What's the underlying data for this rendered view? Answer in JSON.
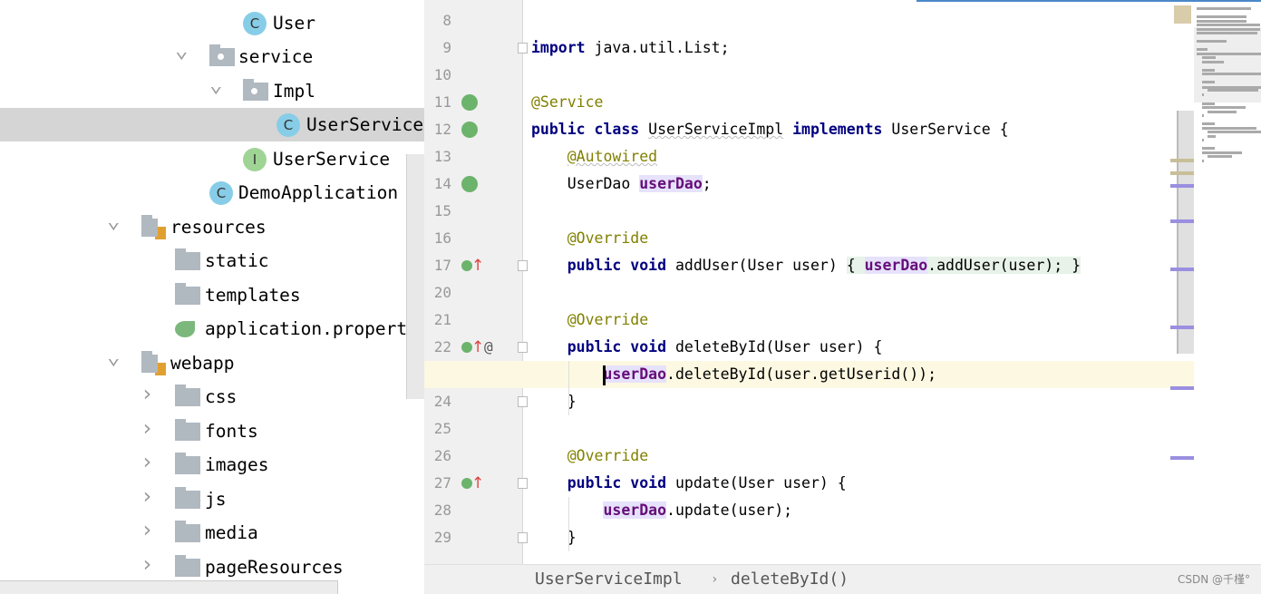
{
  "tree": [
    {
      "label": "User",
      "icon": "class-icon",
      "depth": "c1"
    },
    {
      "label": "service",
      "icon": "package-icon",
      "expanded": true,
      "depth": "f1"
    },
    {
      "label": "Impl",
      "icon": "package-icon",
      "expanded": true,
      "depth": "f2"
    },
    {
      "label": "UserServiceImpl",
      "icon": "class-icon",
      "depth": "c2",
      "selected": true
    },
    {
      "label": "UserService",
      "icon": "interface-icon",
      "depth": "c1"
    },
    {
      "label": "DemoApplication",
      "icon": "spring-boot-class-icon",
      "depth": "c0"
    },
    {
      "label": "resources",
      "icon": "resources-folder-icon",
      "expanded": true,
      "depth": "r"
    },
    {
      "label": "static",
      "icon": "folder-icon",
      "depth": "rc"
    },
    {
      "label": "templates",
      "icon": "folder-icon",
      "depth": "rc"
    },
    {
      "label": "application.properties",
      "icon": "spring-properties-icon",
      "depth": "rc"
    },
    {
      "label": "webapp",
      "icon": "resources-folder-icon",
      "expanded": true,
      "depth": "r"
    },
    {
      "label": "css",
      "icon": "folder-icon",
      "collapsed": true,
      "depth": "rc"
    },
    {
      "label": "fonts",
      "icon": "folder-icon",
      "collapsed": true,
      "depth": "rc"
    },
    {
      "label": "images",
      "icon": "folder-icon",
      "collapsed": true,
      "depth": "rc"
    },
    {
      "label": "js",
      "icon": "folder-icon",
      "collapsed": true,
      "depth": "rc"
    },
    {
      "label": "media",
      "icon": "folder-icon",
      "collapsed": true,
      "depth": "rc"
    },
    {
      "label": "pageResources",
      "icon": "folder-icon",
      "collapsed": true,
      "depth": "rc"
    }
  ],
  "editor": {
    "lines": [
      {
        "n": "8",
        "tokens": []
      },
      {
        "n": "9",
        "fold": true,
        "tokens": [
          {
            "t": "import",
            "c": "kw"
          },
          {
            "t": " java.util.List;"
          }
        ]
      },
      {
        "n": "10",
        "tokens": []
      },
      {
        "n": "11",
        "gutter": "spring-bean-icon",
        "tokens": [
          {
            "t": "@Service",
            "c": "ann"
          }
        ]
      },
      {
        "n": "12",
        "gutter": "spring-class-icon",
        "tokens": [
          {
            "t": "public",
            "c": "kw"
          },
          {
            "t": " "
          },
          {
            "t": "class",
            "c": "kw"
          },
          {
            "t": " "
          },
          {
            "t": "UserServiceImpl",
            "c": "wavy"
          },
          {
            "t": " "
          },
          {
            "t": "implements",
            "c": "kw"
          },
          {
            "t": " UserService {"
          }
        ]
      },
      {
        "n": "13",
        "tokens": [
          {
            "t": "    "
          },
          {
            "t": "@Autowired",
            "c": "ann wavy"
          }
        ]
      },
      {
        "n": "14",
        "gutter": "spring-autowired-icon",
        "tokens": [
          {
            "t": "    UserDao "
          },
          {
            "t": "userDao",
            "c": "fld"
          },
          {
            "t": ";"
          }
        ]
      },
      {
        "n": "15",
        "tokens": []
      },
      {
        "n": "16",
        "tokens": [
          {
            "t": "    "
          },
          {
            "t": "@Override",
            "c": "ann"
          }
        ]
      },
      {
        "n": "17",
        "gutter": "implements-icon",
        "foldplus": true,
        "tokens": [
          {
            "t": "    "
          },
          {
            "t": "public",
            "c": "kw"
          },
          {
            "t": " "
          },
          {
            "t": "void",
            "c": "kw"
          },
          {
            "t": " addUser(User user) "
          },
          {
            "t": "{ ",
            "c": "foldblk"
          },
          {
            "t": "userDao",
            "c": "fld"
          },
          {
            "t": ".addUser(user); ",
            "c": "foldblk"
          },
          {
            "t": "}",
            "c": "foldblk"
          }
        ]
      },
      {
        "n": "20",
        "tokens": []
      },
      {
        "n": "21",
        "tokens": [
          {
            "t": "    "
          },
          {
            "t": "@Override",
            "c": "ann"
          }
        ]
      },
      {
        "n": "22",
        "gutter": "implements-icon",
        "at": "@",
        "fold": true,
        "tokens": [
          {
            "t": "    "
          },
          {
            "t": "public",
            "c": "kw"
          },
          {
            "t": " "
          },
          {
            "t": "void",
            "c": "kw"
          },
          {
            "t": " deleteById(User user) {"
          }
        ]
      },
      {
        "n": "23",
        "current": true,
        "tokens": [
          {
            "t": "        "
          },
          {
            "t": "userDao",
            "c": "fld"
          },
          {
            "t": ".deleteById(user.getUserid());"
          }
        ]
      },
      {
        "n": "24",
        "fold": true,
        "tokens": [
          {
            "t": "    }"
          }
        ]
      },
      {
        "n": "25",
        "tokens": []
      },
      {
        "n": "26",
        "tokens": [
          {
            "t": "    "
          },
          {
            "t": "@Override",
            "c": "ann"
          }
        ]
      },
      {
        "n": "27",
        "gutter": "implements-icon",
        "fold": true,
        "tokens": [
          {
            "t": "    "
          },
          {
            "t": "public",
            "c": "kw"
          },
          {
            "t": " "
          },
          {
            "t": "void",
            "c": "kw"
          },
          {
            "t": " update(User user) {"
          }
        ]
      },
      {
        "n": "28",
        "tokens": [
          {
            "t": "        "
          },
          {
            "t": "userDao",
            "c": "fld"
          },
          {
            "t": ".update(user);"
          }
        ]
      },
      {
        "n": "29",
        "fold": true,
        "tokens": [
          {
            "t": "    }"
          }
        ]
      }
    ]
  },
  "breadcrumb": {
    "items": [
      "UserServiceImpl",
      "deleteById()"
    ],
    "separator": "›"
  },
  "watermark": "CSDN @千槿°",
  "colors": {
    "keyword": "#000080",
    "annotation": "#808000",
    "field": "#660e7a",
    "current_line": "#fdf8e2",
    "selection": "#d5d5d5"
  }
}
